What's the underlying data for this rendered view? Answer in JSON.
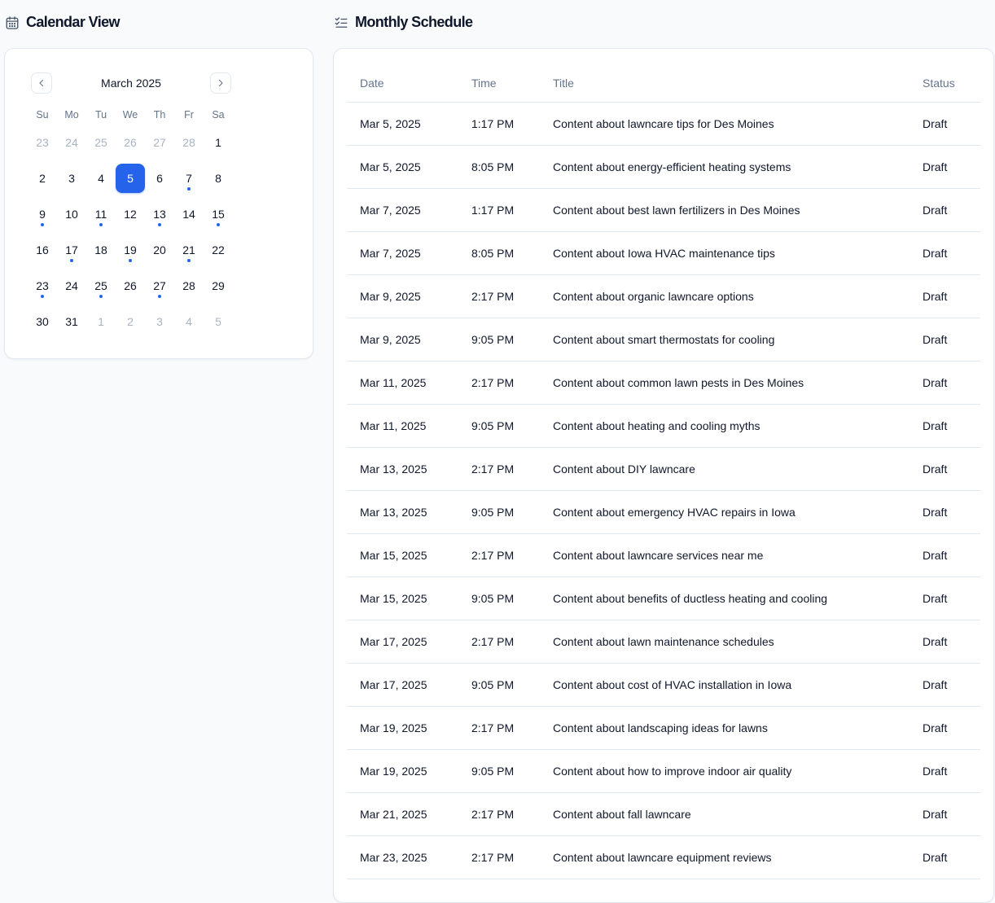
{
  "calendar_section": {
    "title": "Calendar View",
    "icon": "calendar-icon",
    "month_label": "March 2025",
    "prev_icon": "chevron-left-icon",
    "next_icon": "chevron-right-icon",
    "weekdays": [
      "Su",
      "Mo",
      "Tu",
      "We",
      "Th",
      "Fr",
      "Sa"
    ],
    "accent_color": "#2563eb",
    "days": [
      {
        "label": "23",
        "outside": true,
        "selected": false,
        "event": false
      },
      {
        "label": "24",
        "outside": true,
        "selected": false,
        "event": false
      },
      {
        "label": "25",
        "outside": true,
        "selected": false,
        "event": false
      },
      {
        "label": "26",
        "outside": true,
        "selected": false,
        "event": false
      },
      {
        "label": "27",
        "outside": true,
        "selected": false,
        "event": false
      },
      {
        "label": "28",
        "outside": true,
        "selected": false,
        "event": false
      },
      {
        "label": "1",
        "outside": false,
        "selected": false,
        "event": false
      },
      {
        "label": "2",
        "outside": false,
        "selected": false,
        "event": false
      },
      {
        "label": "3",
        "outside": false,
        "selected": false,
        "event": false
      },
      {
        "label": "4",
        "outside": false,
        "selected": false,
        "event": false
      },
      {
        "label": "5",
        "outside": false,
        "selected": true,
        "event": true
      },
      {
        "label": "6",
        "outside": false,
        "selected": false,
        "event": false
      },
      {
        "label": "7",
        "outside": false,
        "selected": false,
        "event": true
      },
      {
        "label": "8",
        "outside": false,
        "selected": false,
        "event": false
      },
      {
        "label": "9",
        "outside": false,
        "selected": false,
        "event": true
      },
      {
        "label": "10",
        "outside": false,
        "selected": false,
        "event": false
      },
      {
        "label": "11",
        "outside": false,
        "selected": false,
        "event": true
      },
      {
        "label": "12",
        "outside": false,
        "selected": false,
        "event": false
      },
      {
        "label": "13",
        "outside": false,
        "selected": false,
        "event": true
      },
      {
        "label": "14",
        "outside": false,
        "selected": false,
        "event": false
      },
      {
        "label": "15",
        "outside": false,
        "selected": false,
        "event": true
      },
      {
        "label": "16",
        "outside": false,
        "selected": false,
        "event": false
      },
      {
        "label": "17",
        "outside": false,
        "selected": false,
        "event": true
      },
      {
        "label": "18",
        "outside": false,
        "selected": false,
        "event": false
      },
      {
        "label": "19",
        "outside": false,
        "selected": false,
        "event": true
      },
      {
        "label": "20",
        "outside": false,
        "selected": false,
        "event": false
      },
      {
        "label": "21",
        "outside": false,
        "selected": false,
        "event": true
      },
      {
        "label": "22",
        "outside": false,
        "selected": false,
        "event": false
      },
      {
        "label": "23",
        "outside": false,
        "selected": false,
        "event": true
      },
      {
        "label": "24",
        "outside": false,
        "selected": false,
        "event": false
      },
      {
        "label": "25",
        "outside": false,
        "selected": false,
        "event": true
      },
      {
        "label": "26",
        "outside": false,
        "selected": false,
        "event": false
      },
      {
        "label": "27",
        "outside": false,
        "selected": false,
        "event": true
      },
      {
        "label": "28",
        "outside": false,
        "selected": false,
        "event": false
      },
      {
        "label": "29",
        "outside": false,
        "selected": false,
        "event": false
      },
      {
        "label": "30",
        "outside": false,
        "selected": false,
        "event": false
      },
      {
        "label": "31",
        "outside": false,
        "selected": false,
        "event": false
      },
      {
        "label": "1",
        "outside": true,
        "selected": false,
        "event": false
      },
      {
        "label": "2",
        "outside": true,
        "selected": false,
        "event": false
      },
      {
        "label": "3",
        "outside": true,
        "selected": false,
        "event": false
      },
      {
        "label": "4",
        "outside": true,
        "selected": false,
        "event": false
      },
      {
        "label": "5",
        "outside": true,
        "selected": false,
        "event": false
      }
    ]
  },
  "schedule_section": {
    "title": "Monthly Schedule",
    "icon": "list-checks-icon",
    "columns": [
      "Date",
      "Time",
      "Title",
      "Status"
    ],
    "rows": [
      {
        "date": "Mar 5, 2025",
        "time": "1:17 PM",
        "title": "Content about lawncare tips for Des Moines",
        "status": "Draft"
      },
      {
        "date": "Mar 5, 2025",
        "time": "8:05 PM",
        "title": "Content about energy-efficient heating systems",
        "status": "Draft"
      },
      {
        "date": "Mar 7, 2025",
        "time": "1:17 PM",
        "title": "Content about best lawn fertilizers in Des Moines",
        "status": "Draft"
      },
      {
        "date": "Mar 7, 2025",
        "time": "8:05 PM",
        "title": "Content about Iowa HVAC maintenance tips",
        "status": "Draft"
      },
      {
        "date": "Mar 9, 2025",
        "time": "2:17 PM",
        "title": "Content about organic lawncare options",
        "status": "Draft"
      },
      {
        "date": "Mar 9, 2025",
        "time": "9:05 PM",
        "title": "Content about smart thermostats for cooling",
        "status": "Draft"
      },
      {
        "date": "Mar 11, 2025",
        "time": "2:17 PM",
        "title": "Content about common lawn pests in Des Moines",
        "status": "Draft"
      },
      {
        "date": "Mar 11, 2025",
        "time": "9:05 PM",
        "title": "Content about heating and cooling myths",
        "status": "Draft"
      },
      {
        "date": "Mar 13, 2025",
        "time": "2:17 PM",
        "title": "Content about DIY lawncare",
        "status": "Draft"
      },
      {
        "date": "Mar 13, 2025",
        "time": "9:05 PM",
        "title": "Content about emergency HVAC repairs in Iowa",
        "status": "Draft"
      },
      {
        "date": "Mar 15, 2025",
        "time": "2:17 PM",
        "title": "Content about lawncare services near me",
        "status": "Draft"
      },
      {
        "date": "Mar 15, 2025",
        "time": "9:05 PM",
        "title": "Content about benefits of ductless heating and cooling",
        "status": "Draft"
      },
      {
        "date": "Mar 17, 2025",
        "time": "2:17 PM",
        "title": "Content about lawn maintenance schedules",
        "status": "Draft"
      },
      {
        "date": "Mar 17, 2025",
        "time": "9:05 PM",
        "title": "Content about cost of HVAC installation in Iowa",
        "status": "Draft"
      },
      {
        "date": "Mar 19, 2025",
        "time": "2:17 PM",
        "title": "Content about landscaping ideas for lawns",
        "status": "Draft"
      },
      {
        "date": "Mar 19, 2025",
        "time": "9:05 PM",
        "title": "Content about how to improve indoor air quality",
        "status": "Draft"
      },
      {
        "date": "Mar 21, 2025",
        "time": "2:17 PM",
        "title": "Content about fall lawncare",
        "status": "Draft"
      },
      {
        "date": "Mar 23, 2025",
        "time": "2:17 PM",
        "title": "Content about lawncare equipment reviews",
        "status": "Draft"
      }
    ]
  }
}
